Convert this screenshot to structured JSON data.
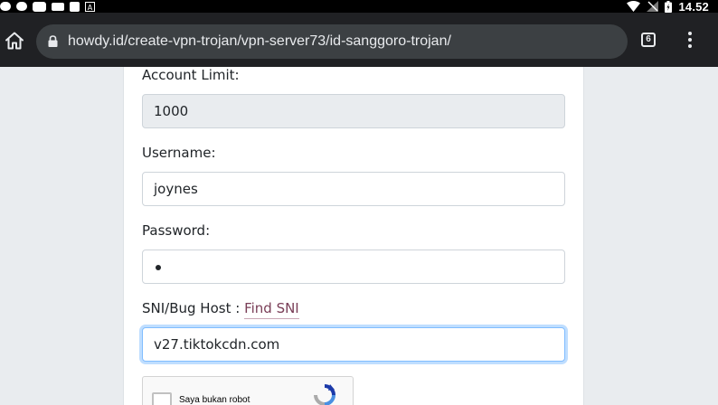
{
  "status_bar": {
    "time": "14.52",
    "left_icons": [
      "notification-dot-icon",
      "notification-dot-icon",
      "chat-icon",
      "keyboard-icon",
      "app-icon",
      "text-a-icon"
    ],
    "right_icons": [
      "wifi-icon",
      "signal-off-icon",
      "battery-charging-icon"
    ],
    "a_glyph": "A"
  },
  "browser": {
    "url": "howdy.id/create-vpn-trojan/vpn-server73/id-sanggoro-trojan/",
    "tab_count": "6"
  },
  "form": {
    "account_limit_label": "Account Limit:",
    "account_limit_value": "1000",
    "username_label": "Username:",
    "username_value": "joynes",
    "password_label": "Password:",
    "password_length": 1,
    "sni_label": "SNI/Bug Host :",
    "find_sni_link": "Find SNI",
    "sni_value": "v27.tiktokcdn.com",
    "recaptcha_label": "Saya bukan robot"
  },
  "colors": {
    "toolbar_bg": "#202124",
    "urlbar_bg": "#3c4043",
    "page_bg": "#e9ecef",
    "link": "#7a3e57",
    "focus_border": "#80bdff"
  }
}
